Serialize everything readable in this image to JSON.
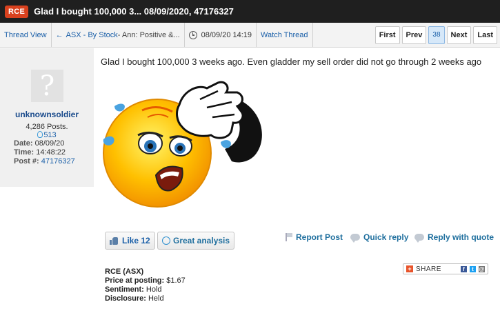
{
  "title_bar": {
    "ticker": "RCE",
    "title": "Glad I bought 100,000 3... 08/09/2020, 47176327"
  },
  "toolbar": {
    "thread_view": "Thread View",
    "breadcrumb_prefix": "←",
    "breadcrumb_link": "ASX - By Stock",
    "breadcrumb_rest": " - Ann: Positive &...",
    "post_datetime": "08/09/20 14:19",
    "watch_thread": "Watch Thread",
    "pager": {
      "first": "First",
      "prev": "Prev",
      "current": "38",
      "next": "Next",
      "last": "Last"
    }
  },
  "author": {
    "avatar_glyph": "?",
    "username": "unknownsoldier",
    "posts": "4,286 Posts.",
    "likes": "513",
    "date_label": "Date:",
    "date": "08/09/20",
    "time_label": "Time:",
    "time": "14:48:22",
    "post_label": "Post #:",
    "post_id": "47176327"
  },
  "post": {
    "text": "Glad I bought 100,000 3 weeks ago. Even gladder my sell order did not go through 2 weeks ago",
    "image_icon": "sweating-emoji-wiping-forehead"
  },
  "actions": {
    "like_label": "Like 12",
    "great_analysis": "Great analysis",
    "report_post": "Report Post",
    "quick_reply": "Quick reply",
    "reply_with_quote": "Reply with quote"
  },
  "info": {
    "stock": "RCE (ASX)",
    "price_label": "Price at posting:",
    "price": "$1.67",
    "sentiment_label": "Sentiment:",
    "sentiment": "Hold",
    "disclosure_label": "Disclosure:",
    "disclosure": "Held"
  },
  "share": {
    "label": "SHARE",
    "icons": [
      "facebook-icon",
      "twitter-icon",
      "email-icon"
    ]
  },
  "colors": {
    "badge": "#d9411e",
    "link": "#1a5fa8",
    "title_bar": "#1f1f1f"
  }
}
